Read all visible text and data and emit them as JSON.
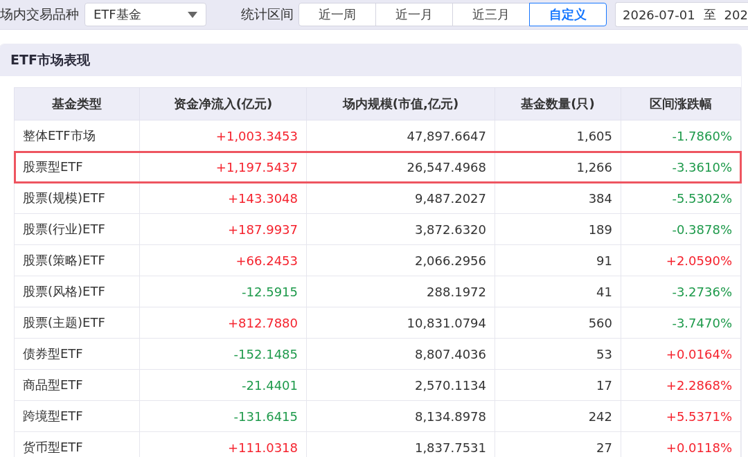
{
  "filters": {
    "venue_label": "场内交易品种",
    "product_select": {
      "value": "ETF基金"
    },
    "period_label": "统计区间",
    "period_tabs": [
      {
        "label": "近一周",
        "selected": false
      },
      {
        "label": "近一月",
        "selected": false
      },
      {
        "label": "近三月",
        "selected": false
      },
      {
        "label": "自定义",
        "selected": true
      }
    ],
    "date_range": {
      "start": "2026-07-01",
      "separator": "至",
      "end": "202"
    }
  },
  "card": {
    "title": "ETF市场表现",
    "table": {
      "columns": [
        "基金类型",
        "资金净流入(亿元)",
        "场内规模(市值,亿元)",
        "基金数量(只)",
        "区间涨跌幅"
      ],
      "rows": [
        {
          "type": "整体ETF市场",
          "net_inflow": {
            "value": "+1,003.3453",
            "rising": true
          },
          "scale": "47,897.6647",
          "count": "1,605",
          "change": {
            "value": "-1.7860%",
            "rising": false
          },
          "highlighted": false
        },
        {
          "type": "股票型ETF",
          "net_inflow": {
            "value": "+1,197.5437",
            "rising": true
          },
          "scale": "26,547.4968",
          "count": "1,266",
          "change": {
            "value": "-3.3610%",
            "rising": false
          },
          "highlighted": true
        },
        {
          "type": "股票(规模)ETF",
          "net_inflow": {
            "value": "+143.3048",
            "rising": true
          },
          "scale": "9,487.2027",
          "count": "384",
          "change": {
            "value": "-5.5302%",
            "rising": false
          },
          "highlighted": false
        },
        {
          "type": "股票(行业)ETF",
          "net_inflow": {
            "value": "+187.9937",
            "rising": true
          },
          "scale": "3,872.6320",
          "count": "189",
          "change": {
            "value": "-0.3878%",
            "rising": false
          },
          "highlighted": false
        },
        {
          "type": "股票(策略)ETF",
          "net_inflow": {
            "value": "+66.2453",
            "rising": true
          },
          "scale": "2,066.2956",
          "count": "91",
          "change": {
            "value": "+2.0590%",
            "rising": true
          },
          "highlighted": false
        },
        {
          "type": "股票(风格)ETF",
          "net_inflow": {
            "value": "-12.5915",
            "rising": false
          },
          "scale": "288.1972",
          "count": "41",
          "change": {
            "value": "-3.2736%",
            "rising": false
          },
          "highlighted": false
        },
        {
          "type": "股票(主题)ETF",
          "net_inflow": {
            "value": "+812.7880",
            "rising": true
          },
          "scale": "10,831.0794",
          "count": "560",
          "change": {
            "value": "-3.7470%",
            "rising": false
          },
          "highlighted": false
        },
        {
          "type": "债券型ETF",
          "net_inflow": {
            "value": "-152.1485",
            "rising": false
          },
          "scale": "8,807.4036",
          "count": "53",
          "change": {
            "value": "+0.0164%",
            "rising": true
          },
          "highlighted": false
        },
        {
          "type": "商品型ETF",
          "net_inflow": {
            "value": "-21.4401",
            "rising": false
          },
          "scale": "2,570.1134",
          "count": "17",
          "change": {
            "value": "+2.2868%",
            "rising": true
          },
          "highlighted": false
        },
        {
          "type": "跨境型ETF",
          "net_inflow": {
            "value": "-131.6415",
            "rising": false
          },
          "scale": "8,134.8978",
          "count": "242",
          "change": {
            "value": "+5.5371%",
            "rising": true
          },
          "highlighted": false
        },
        {
          "type": "货币型ETF",
          "net_inflow": {
            "value": "+111.0318",
            "rising": true
          },
          "scale": "1,837.7531",
          "count": "27",
          "change": {
            "value": "+0.0118%",
            "rising": true
          },
          "highlighted": false
        }
      ]
    }
  }
}
